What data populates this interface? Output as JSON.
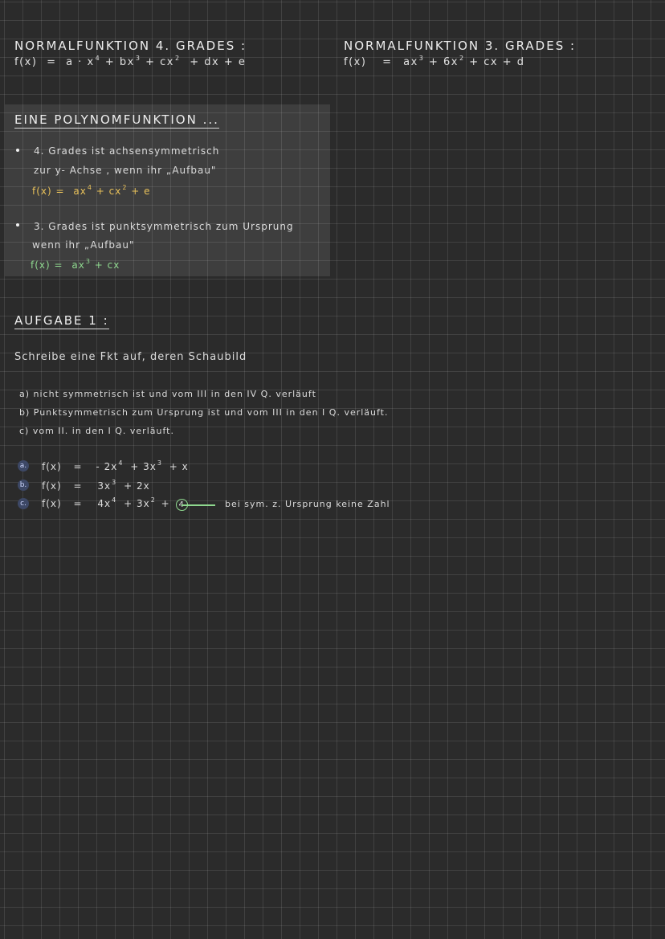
{
  "normal4": {
    "title": "NORMALFUNKTION 4. GRADES :",
    "lhs": "f(x)",
    "eq": "=",
    "t1": "a · x",
    "t1_exp": "4",
    "t2": "+ bx",
    "t2_exp": "3",
    "t3": "+ cx",
    "t3_exp": "2",
    "t4": "+ dx + e"
  },
  "normal3": {
    "title": "NORMALFUNKTION 3. GRADES :",
    "lhs": "f(x)",
    "eq": "=",
    "t1": "ax",
    "t1_exp": "3",
    "t2": "+ 6x",
    "t2_exp": "2",
    "t3": "+ cx + d"
  },
  "polynom": {
    "title": "EINE POLYNOMFUNKTION ...",
    "item1_line1": "4. Grades ist achsensymmetrisch",
    "item1_line2": "zur y- Achse , wenn ihr „Aufbau\"",
    "item1_formula_lhs": "f(x) =",
    "item1_formula_t1": "ax",
    "item1_formula_t1_exp": "4",
    "item1_formula_t2": "+ cx",
    "item1_formula_t2_exp": "2",
    "item1_formula_t3": "+ e",
    "item2_line1": "3. Grades ist punktsymmetrisch zum Ursprung",
    "item2_line2": "wenn ihr „Aufbau\"",
    "item2_formula_lhs": "f(x) =",
    "item2_formula_t1": "ax",
    "item2_formula_t1_exp": "3",
    "item2_formula_t2": "+ cx"
  },
  "aufgabe": {
    "title": "AUFGABE 1 :",
    "intro": "Schreibe eine Fkt auf, deren Schaubild",
    "tasks": [
      "a) nicht symmetrisch ist und vom III in den IV Q. verläuft",
      "b) Punktsymmetrisch zum Ursprung ist und vom III in den I Q. verläuft.",
      "c) vom II. in den I Q. verläuft."
    ],
    "answers": [
      {
        "label": "a.",
        "lhs": "f(x)",
        "eq": "=",
        "t1": "- 2x",
        "t1_exp": "4",
        "t2": "+ 3x",
        "t2_exp": "3",
        "t3": "+ x"
      },
      {
        "label": "b.",
        "lhs": "f(x)",
        "eq": "=",
        "t1": "3x",
        "t1_exp": "3",
        "t2": "+ 2x"
      },
      {
        "label": "c.",
        "lhs": "f(x)",
        "eq": "=",
        "t1": "4x",
        "t1_exp": "4",
        "t2": "+ 3x",
        "t2_exp": "2",
        "t3": "+",
        "circled": "4"
      }
    ],
    "note": "bei sym. z. Ursprung keine Zahl"
  },
  "colors": {
    "background": "#2b2b2b",
    "yellow": "#e8c15a",
    "green": "#8fd88f",
    "badge": "#3d4866"
  }
}
